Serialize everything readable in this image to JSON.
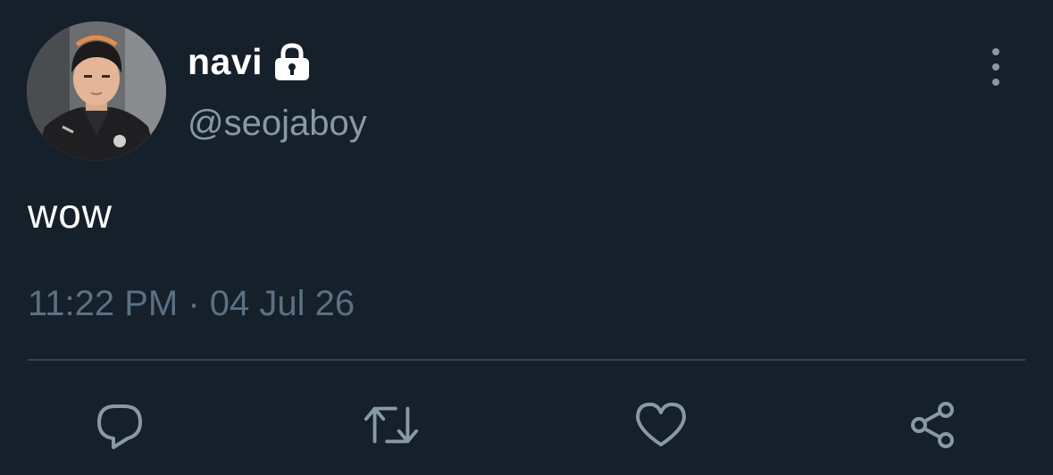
{
  "tweet": {
    "author": {
      "display_name": "navi",
      "handle": "@seojaboy",
      "protected_icon": "lock-icon",
      "avatar": "profile-photo"
    },
    "text": "wow",
    "timestamp": "11:22 PM · 04 Jul 26",
    "more_icon": "more-vertical-icon"
  },
  "actions": [
    {
      "name": "reply",
      "icon": "reply-icon"
    },
    {
      "name": "retweet",
      "icon": "retweet-icon"
    },
    {
      "name": "like",
      "icon": "heart-icon"
    },
    {
      "name": "share",
      "icon": "share-icon"
    }
  ],
  "colors": {
    "background": "#15202b",
    "primary_text": "#ffffff",
    "secondary_text": "#8899a6",
    "timestamp_text": "#5b7083",
    "divider": "#38444d",
    "icon": "#8899a6"
  }
}
